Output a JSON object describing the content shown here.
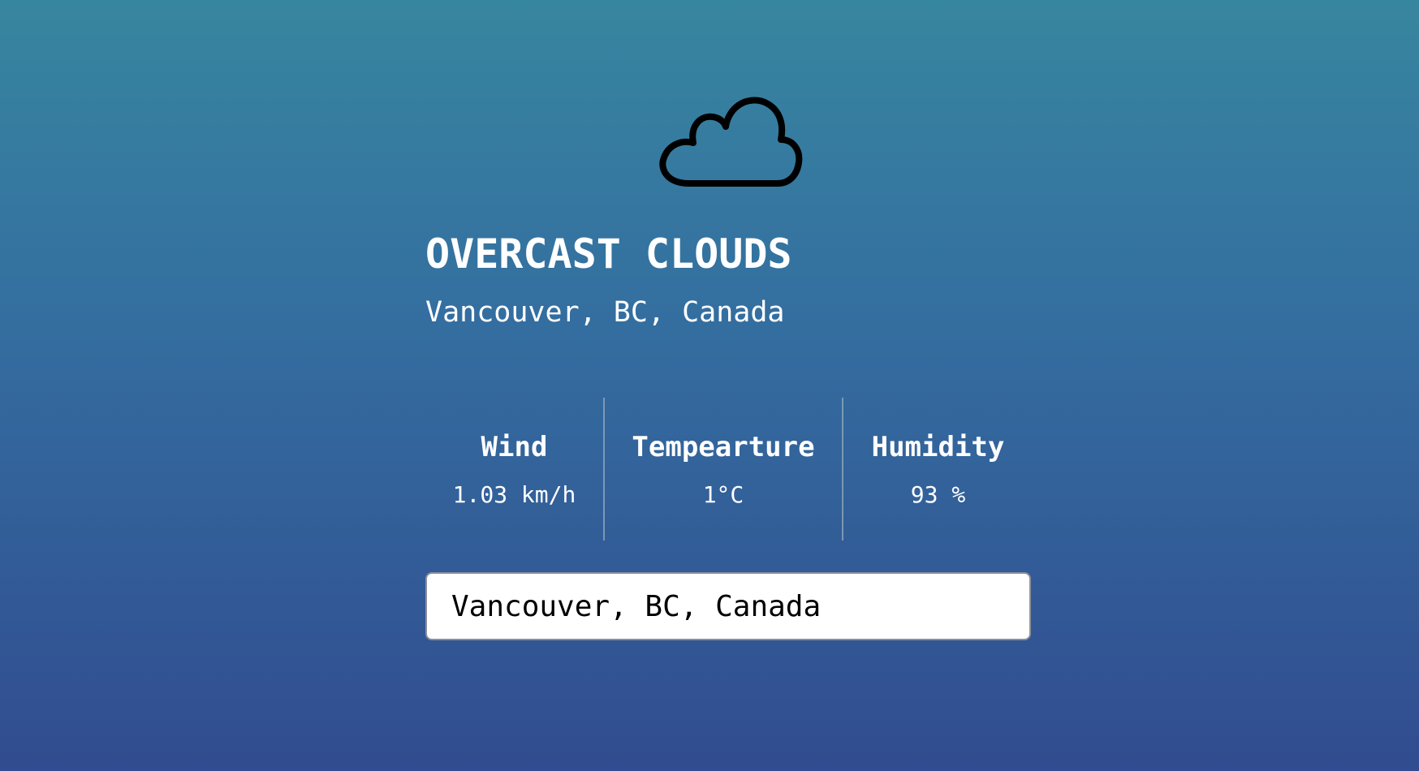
{
  "weather": {
    "icon": "cloud-icon",
    "condition": "OVERCAST CLOUDS",
    "location": "Vancouver, BC, Canada"
  },
  "stats": {
    "wind": {
      "label": "Wind",
      "value": "1.03 km/h"
    },
    "temperature": {
      "label": "Tempearture",
      "value": "1°C"
    },
    "humidity": {
      "label": "Humidity",
      "value": "93 %"
    }
  },
  "search": {
    "value": "Vancouver, BC, Canada"
  },
  "colors": {
    "background_top": "#37869f",
    "background_bottom": "#314c90",
    "text": "#ffffff",
    "icon_stroke": "#000000"
  }
}
